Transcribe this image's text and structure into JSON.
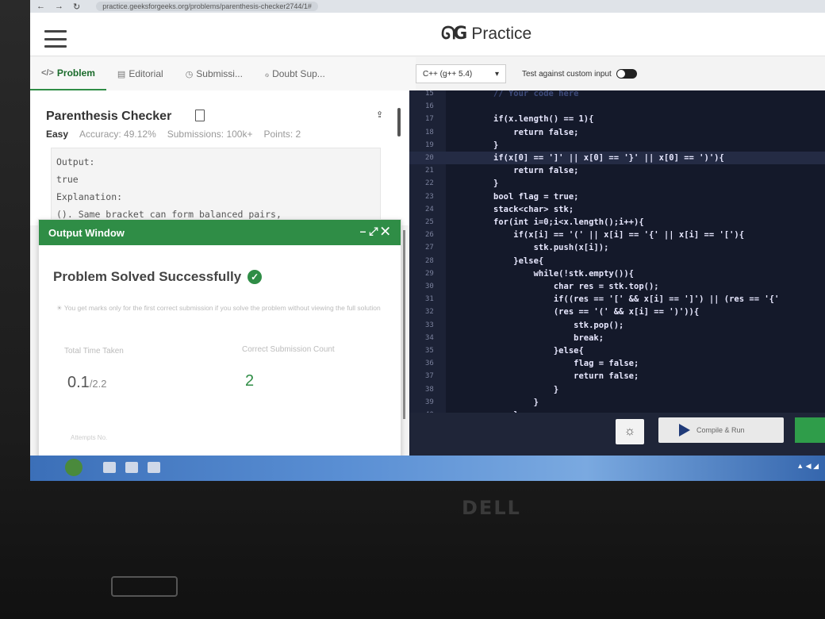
{
  "browser": {
    "url": "practice.geeksforgeeks.org/problems/parenthesis-checker2744/1#"
  },
  "header": {
    "logo_mark": "ᘏG",
    "logo_text": "Practice"
  },
  "tabs": [
    {
      "icon": "</>",
      "label": "Problem"
    },
    {
      "icon": "▤",
      "label": "Editorial"
    },
    {
      "icon": "◷",
      "label": "Submissi..."
    },
    {
      "icon": "ℴ",
      "label": "Doubt Sup..."
    }
  ],
  "problem": {
    "title": "Parenthesis Checker",
    "difficulty": "Easy",
    "accuracy": "Accuracy: 49.12%",
    "submissions": "Submissions: 100k+",
    "points": "Points: 2",
    "example_lines": [
      "Output:",
      "true",
      "Explanation:",
      "(). Same bracket can form balanced pairs,"
    ]
  },
  "output_window": {
    "title": "Output Window",
    "controls": "– ⤢ ✕",
    "status": "Problem Solved Successfully",
    "note": "You get marks only for the first correct submission if you solve the problem without viewing the full solution",
    "time_label": "Total Time Taken",
    "time_value": "0.1",
    "time_limit": "/2.2",
    "count_label": "Correct Submission Count",
    "count_value": "2",
    "attempts_label": "Attempts No."
  },
  "editor": {
    "language": "C++ (g++ 5.4)",
    "custom_input_label": "Test against custom input",
    "lines": [
      {
        "n": "15",
        "code": "// Your code here"
      },
      {
        "n": "16",
        "code": ""
      },
      {
        "n": "17",
        "code": "if(x.length() == 1){"
      },
      {
        "n": "18",
        "code": "    return false;"
      },
      {
        "n": "19",
        "code": "}"
      },
      {
        "n": "20",
        "code": "if(x[0] == ']' || x[0] == '}' || x[0] == ')'){"
      },
      {
        "n": "21",
        "code": "    return false;"
      },
      {
        "n": "22",
        "code": "}"
      },
      {
        "n": "23",
        "code": "bool flag = true;"
      },
      {
        "n": "24",
        "code": "stack<char> stk;"
      },
      {
        "n": "25",
        "code": "for(int i=0;i<x.length();i++){"
      },
      {
        "n": "26",
        "code": "    if(x[i] == '(' || x[i] == '{' || x[i] == '['){"
      },
      {
        "n": "27",
        "code": "        stk.push(x[i]);"
      },
      {
        "n": "28",
        "code": "    }else{"
      },
      {
        "n": "29",
        "code": "        while(!stk.empty()){"
      },
      {
        "n": "30",
        "code": "            char res = stk.top();"
      },
      {
        "n": "31",
        "code": "            if((res == '[' && x[i] == ']') || (res == '{'"
      },
      {
        "n": "32",
        "code": "            (res == '(' && x[i] == ')')){"
      },
      {
        "n": "33",
        "code": "                stk.pop();"
      },
      {
        "n": "34",
        "code": "                break;"
      },
      {
        "n": "35",
        "code": "            }else{"
      },
      {
        "n": "36",
        "code": "                flag = false;"
      },
      {
        "n": "37",
        "code": "                return false;"
      },
      {
        "n": "38",
        "code": "            }"
      },
      {
        "n": "39",
        "code": "        }"
      },
      {
        "n": "40",
        "code": "    }"
      }
    ],
    "compile_label": "Compile & Run"
  },
  "laptop": {
    "brand": "DELL"
  }
}
